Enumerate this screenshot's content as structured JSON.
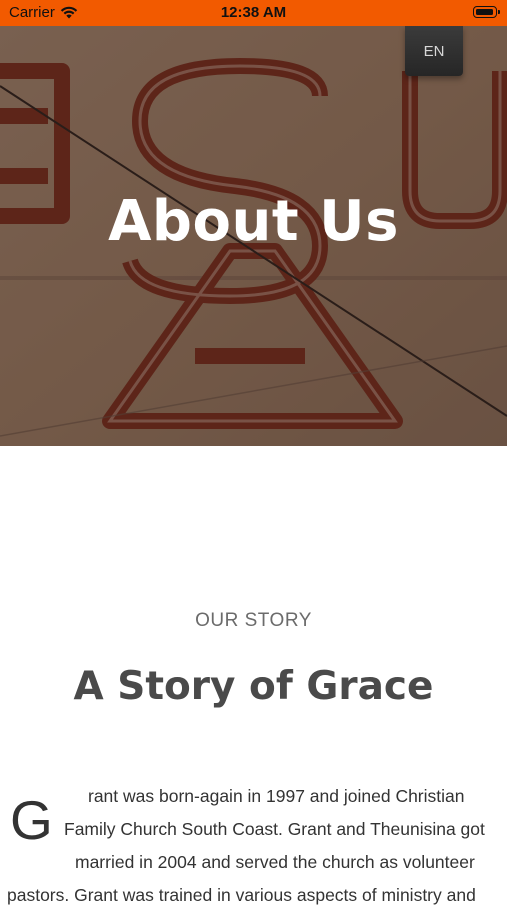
{
  "status_bar": {
    "carrier": "Carrier",
    "time": "12:38 AM",
    "icons": [
      "wifi-icon",
      "battery-icon"
    ],
    "background": "#f25a00"
  },
  "hero": {
    "title": "About Us",
    "language_button": "EN"
  },
  "story": {
    "eyebrow": "OUR STORY",
    "title": "A Story of Grace",
    "drop_cap": "G",
    "lines": [
      "rant was born-again in 1997 and joined Christian",
      "Family Church  South Coast. Grant and Theunisina got",
      "married in 2004 and served the church as volunteer",
      "pastors. Grant was trained in various aspects of ministry and"
    ]
  },
  "colors": {
    "accent": "#f25a00",
    "text_dark": "#333333",
    "text_muted": "#6b6b6b"
  }
}
